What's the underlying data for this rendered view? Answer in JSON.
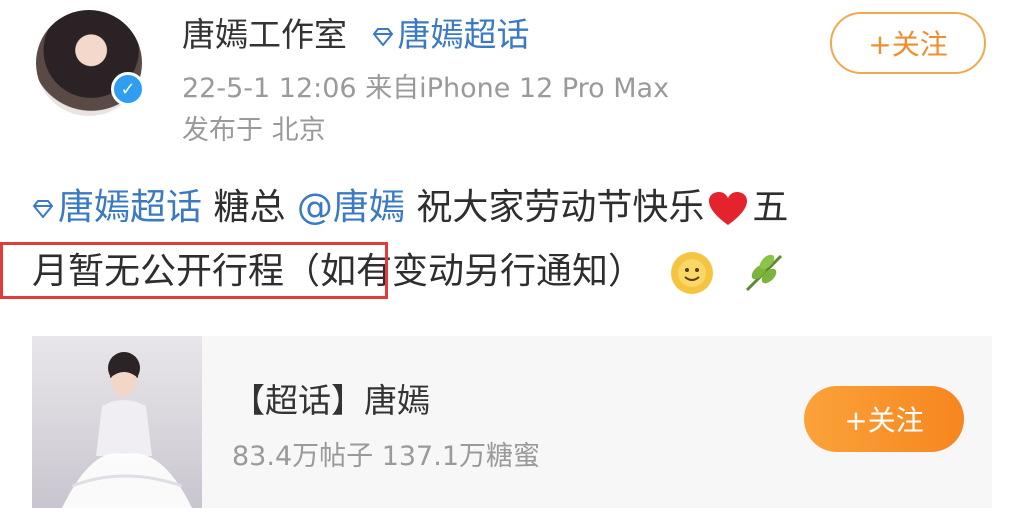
{
  "post": {
    "author": "唐嫣工作室",
    "topic_tag": "唐嫣超话",
    "follow_label": "+关注",
    "timestamp": "22-5-1 12:06",
    "source": "来自iPhone 12 Pro Max",
    "location": "发布于 北京",
    "content": {
      "topic": "唐嫣超话",
      "text1": " 糖总 ",
      "mention": "@唐嫣",
      "text2": " 祝大家劳动节快乐",
      "text3": "五",
      "line2_a": "月暂无公开行程",
      "line2_b": "（如有变动另行通知）"
    }
  },
  "card": {
    "title": "【超话】唐嫣",
    "stats": "83.4万帖子 137.1万糖蜜",
    "follow_label": "+关注"
  },
  "colors": {
    "link": "#3a79c4",
    "accent_orange": "#f08d2c",
    "highlight_red": "#e23b3b",
    "verified_blue": "#2e9df2"
  },
  "icons": [
    "verified-badge-icon",
    "diamond-topic-icon",
    "heart-emoji-icon",
    "sun-emoji-icon",
    "leaf-emoji-icon"
  ]
}
